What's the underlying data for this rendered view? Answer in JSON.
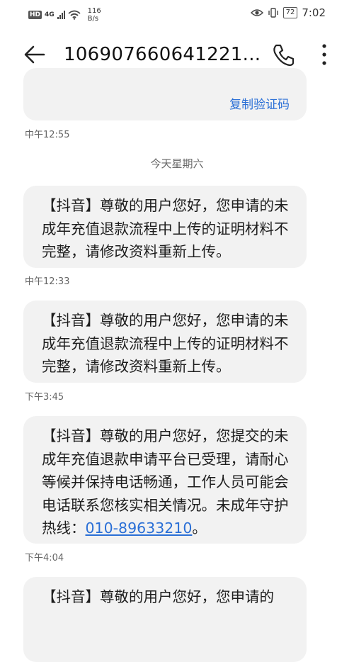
{
  "status_bar": {
    "hd": "HD",
    "network": "4G",
    "speed_value": "116",
    "speed_unit": "B/s",
    "battery": "72",
    "time": "7:02"
  },
  "header": {
    "title": "106907660641221..."
  },
  "messages": {
    "top_bubble": {
      "copy_code_label": "复制验证码",
      "time": "中午12:55"
    },
    "date_separator": "今天星期六",
    "items": [
      {
        "text": "【抖音】尊敬的用户您好，您申请的未成年充值退款流程中上传的证明材料不完整，请修改资料重新上传。",
        "time": "中午12:33"
      },
      {
        "text": "【抖音】尊敬的用户您好，您申请的未成年充值退款流程中上传的证明材料不完整，请修改资料重新上传。",
        "time": "下午3:45"
      },
      {
        "text": "【抖音】尊敬的用户您好，您提交的未成年充值退款申请平台已受理，请耐心等候并保持电话畅通，工作人员可能会电话联系您核实相关情况。未成年守护热线：",
        "hotline": "010-89633210",
        "suffix": "。",
        "time": "下午4:04"
      },
      {
        "text": "【抖音】尊敬的用户您好，您申请的"
      }
    ]
  }
}
